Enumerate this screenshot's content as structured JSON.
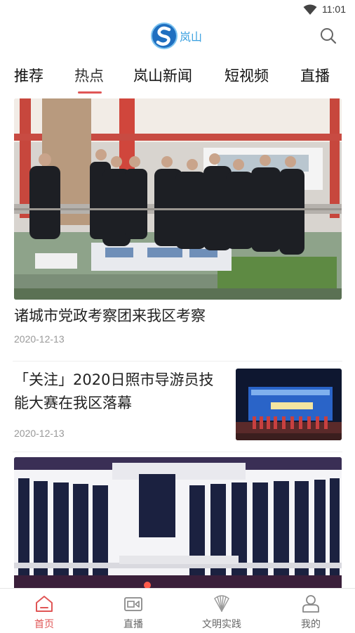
{
  "status_bar": {
    "time": "11:01",
    "icons": [
      "wifi-icon"
    ]
  },
  "header": {
    "logo_text": "岚山",
    "search_icon": "search-icon"
  },
  "tabs": [
    {
      "label": "推荐",
      "active": false
    },
    {
      "label": "热点",
      "active": true
    },
    {
      "label": "岚山新闻",
      "active": false
    },
    {
      "label": "短视频",
      "active": false
    },
    {
      "label": "直播",
      "active": false
    }
  ],
  "feed": {
    "items": [
      {
        "title": "诸城市党政考察团来我区考察",
        "date": "2020-12-13",
        "layout": "large-image"
      },
      {
        "title": "「关注」2020日照市导游员技能大赛在我区落幕",
        "date": "2020-12-13",
        "layout": "right-thumbnail"
      },
      {
        "title": "",
        "date": "",
        "layout": "large-image"
      }
    ]
  },
  "bottom_nav": {
    "accent_color": "#e05656",
    "items": [
      {
        "label": "首页",
        "icon": "home-icon",
        "active": true
      },
      {
        "label": "直播",
        "icon": "video-camera-icon",
        "active": false
      },
      {
        "label": "文明实践",
        "icon": "emblem-icon",
        "active": false
      },
      {
        "label": "我的",
        "icon": "user-icon",
        "active": false
      }
    ]
  }
}
